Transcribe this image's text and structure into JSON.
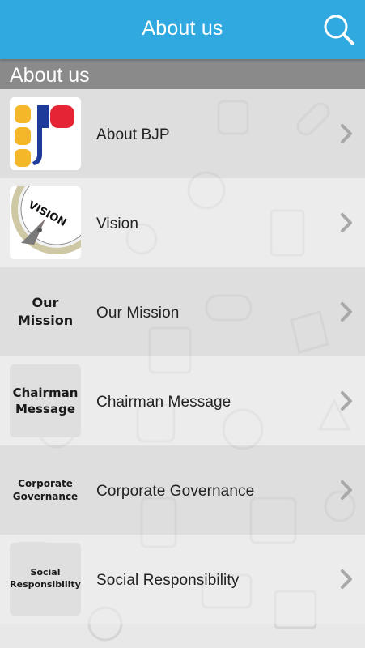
{
  "app": {
    "title": "About us",
    "search_icon": "search-icon"
  },
  "section": {
    "title": "About us"
  },
  "colors": {
    "appbar": "#2fa9e0",
    "section_header": "#8a8a8a",
    "chevron": "#a8a8a8"
  },
  "items": [
    {
      "label": "About BJP",
      "thumb_type": "bjp-logo",
      "thumb_text": ""
    },
    {
      "label": "Vision",
      "thumb_type": "vision-compass",
      "thumb_text": "VISION"
    },
    {
      "label": "Our Mission",
      "thumb_type": "text",
      "thumb_text": "Our\nMission"
    },
    {
      "label": "Chairman Message",
      "thumb_type": "text",
      "thumb_text": "Chairman\nMessage"
    },
    {
      "label": "Corporate Governance",
      "thumb_type": "text",
      "thumb_text": "Corporate\nGovernance"
    },
    {
      "label": "Social Responsibility",
      "thumb_type": "text",
      "thumb_text": "Social\nResponsibility"
    }
  ]
}
